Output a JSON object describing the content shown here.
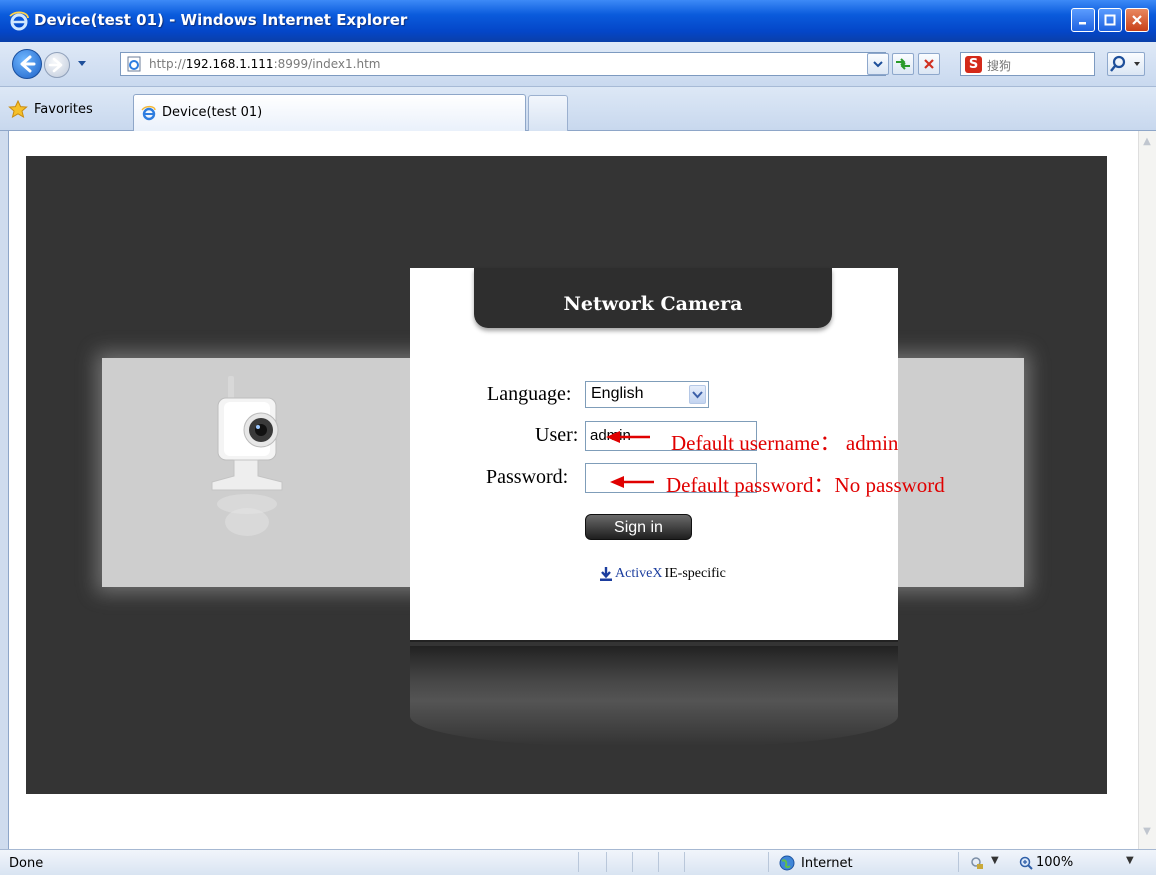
{
  "window": {
    "title": "Device(test 01) - Windows Internet Explorer"
  },
  "navigation": {
    "address_prefix": "http://",
    "address_host": "192.168.1.111",
    "address_rest": ":8999/index1.htm",
    "search_placeholder": "搜狗",
    "search_logo": "S"
  },
  "tabs": {
    "favorites_label": "Favorites",
    "active_tab_label": "Device(test 01)"
  },
  "login": {
    "title": "Network Camera",
    "language_label": "Language:",
    "language_value": "English",
    "user_label": "User:",
    "user_value": "admin",
    "password_label": "Password:",
    "signin_label": "Sign in",
    "activex_link": "ActiveX",
    "activex_suffix": "IE-specific"
  },
  "annotations": {
    "username_note": "Default username： admin",
    "password_note": "Default password：No password",
    "color": "#e00000"
  },
  "statusbar": {
    "status": "Done",
    "zone": "Internet",
    "zoom": "100%"
  },
  "colors": {
    "titlebar": "#0a5bdc",
    "stage_background": "#343434",
    "link": "#1b3d9e"
  }
}
